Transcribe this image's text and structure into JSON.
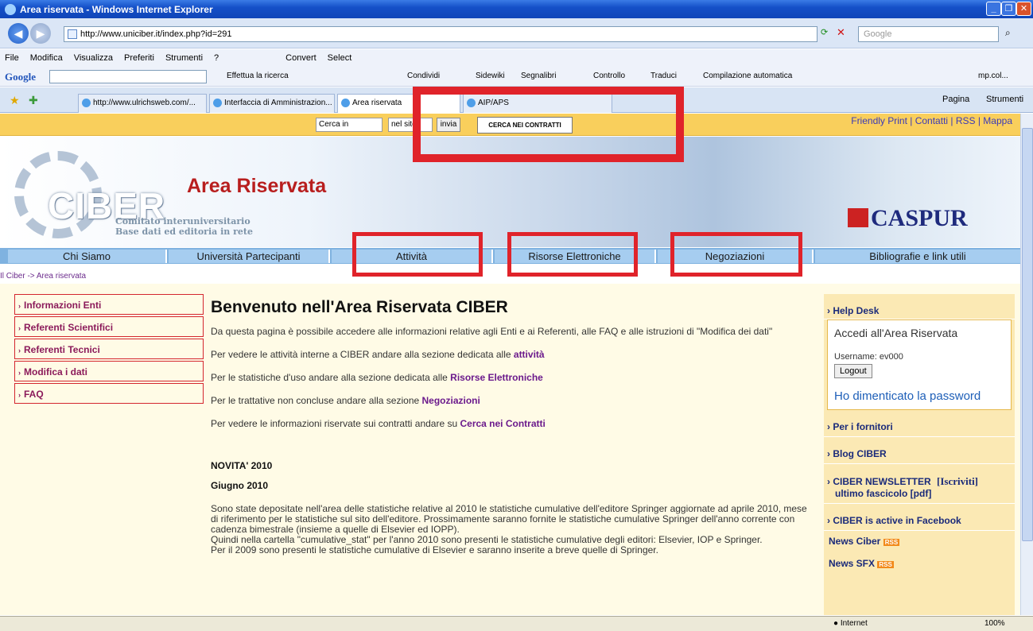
{
  "window": {
    "title": "Area riservata - Windows Internet Explorer"
  },
  "address": {
    "url": "http://www.uniciber.it/index.php?id=291",
    "search_placeholder": "Google"
  },
  "menu": [
    "File",
    "Modifica",
    "Visualizza",
    "Preferiti",
    "Strumenti",
    "?"
  ],
  "menu_extra": {
    "convert": "Convert",
    "select": "Select"
  },
  "google_toolbar": {
    "logo": "Google",
    "items": [
      "Effettua la ricerca",
      "Condividi",
      "Sidewiki",
      "Segnalibri",
      "Controllo",
      "Traduci",
      "Compilazione automatica"
    ],
    "user": "mp.col..."
  },
  "tabs": [
    {
      "label": "http://www.ulrichsweb.com/...",
      "active": false
    },
    {
      "label": "Interfaccia di Amministrazion...",
      "active": false
    },
    {
      "label": "Area riservata",
      "active": true
    },
    {
      "label": "AIP/APS",
      "active": false
    }
  ],
  "ie_tools": {
    "pagina": "Pagina",
    "strumenti": "Strumenti"
  },
  "site": {
    "search_label": "Cerca in",
    "search_scope": "nel sito",
    "search_button": "invia",
    "cerca_contratti": "CERCA NEI CONTRATTI",
    "top_links": "Friendly Print | Contatti | RSS | Mappa",
    "banner_title": "Area Riservata",
    "logo_text": "CIBER",
    "comitato_line1": "Comitato interuniversitario",
    "comitato_line2": "Base dati ed editoria in rete",
    "caspur": "CASPUR",
    "nav": [
      "Chi Siamo",
      "Università Partecipanti",
      "Attività",
      "Risorse Elettroniche",
      "Negoziazioni",
      "Bibliografie e link utili"
    ],
    "breadcrumb": "Il Ciber -> Area riservata",
    "left_menu": [
      "Informazioni Enti",
      "Referenti Scientifici",
      "Referenti Tecnici",
      "Modifica i dati",
      "FAQ"
    ],
    "heading": "Benvenuto nell'Area Riservata CIBER",
    "intro": "Da questa pagina è possibile accedere alle informazioni relative agli Enti e ai Referenti, alle FAQ e alle istruzioni di \"Modifica dei dati\"",
    "p1_text": "Per vedere le attività interne a CIBER andare alla sezione dedicata alle ",
    "p1_link": "attività",
    "p2_text": "Per le statistiche d'uso andare alla sezione dedicata alle ",
    "p2_link": "Risorse Elettroniche",
    "p3_text": "Per le trattative non concluse andare alla sezione ",
    "p3_link": "Negoziazioni",
    "p4_text": "Per vedere le informazioni riservate sui contratti andare su ",
    "p4_link": "Cerca nei Contratti",
    "novita": "NOVITA' 2010",
    "giugno": "Giugno 2010",
    "news_text": "Sono state depositate nell'area delle statistiche relative al 2010  le statistiche cumulative dell'editore Springer aggiornate ad aprile 2010, mese di riferimento per le statistiche sul sito dell'editore. Prossimamente saranno fornite le statistiche cumulative Springer dell'anno corrente con cadenza bimestrale (insieme a quelle di Elsevier ed IOPP).",
    "news_text2": "Quindi nella cartella \"cumulative_stat\" per l'anno 2010 sono presenti le statistiche cumulative degli editori: Elsevier, IOP e Springer.",
    "news_text3": "Per il 2009 sono presenti le statistiche cumulative di Elsevier e saranno inserite a breve quelle di Springer.",
    "right": {
      "help_desk": "Help Desk",
      "accedi": "Accedi all'Area Riservata",
      "username": "Username: ev000",
      "logout": "Logout",
      "forgot": "Ho dimenticato la password",
      "fornitori": "Per i fornitori",
      "blog": "Blog CIBER",
      "newsletter": "CIBER NEWSLETTER",
      "iscriviti": "[Iscriviti]",
      "fascicolo": "ultimo fascicolo [pdf]",
      "facebook": "CIBER is active in Facebook",
      "news_ciber": "News Ciber",
      "news_sfx": "News SFX",
      "rss": "RSS"
    }
  },
  "status": {
    "zone": "Internet",
    "zoom": "100%"
  },
  "colors": {
    "highlight_red": "#e0232a",
    "nav_blue": "#a6cdf0",
    "top_strip": "#f9cf5c",
    "content_bg": "#fffbe6"
  }
}
